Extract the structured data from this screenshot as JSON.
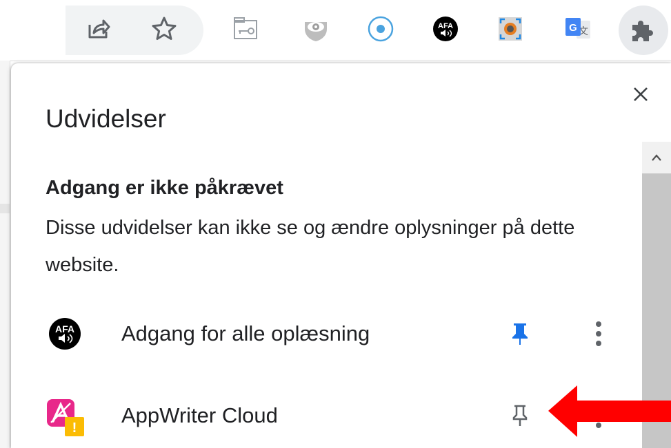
{
  "toolbar": {
    "icons": [
      "share-icon",
      "bookmark-star-icon",
      "key-extension-icon",
      "eye-extension-icon",
      "circle-dot-extension-icon",
      "afa-extension-icon",
      "screen-capture-extension-icon",
      "google-translate-extension-icon",
      "puzzle-piece-icon"
    ],
    "afa_label": "AFA"
  },
  "popup": {
    "title": "Udvidelser",
    "close_icon": "close-icon",
    "section": {
      "heading": "Adgang er ikke påkrævet",
      "description": "Disse udvidelser kan ikke se og ændre oplysninger på dette website."
    },
    "extensions": [
      {
        "name": "Adgang for alle oplæsning",
        "icon": "afa-icon",
        "icon_text": "AFA",
        "pinned": true
      },
      {
        "name": "AppWriter Cloud",
        "icon": "appwriter-icon",
        "badge": "!",
        "pinned": false
      }
    ]
  },
  "colors": {
    "pin_active": "#1a73e8",
    "pin_inactive": "#5f6368",
    "annotation_arrow": "#ff0000",
    "appwriter_pink": "#e8288a",
    "warning_badge": "#fbbc04"
  }
}
